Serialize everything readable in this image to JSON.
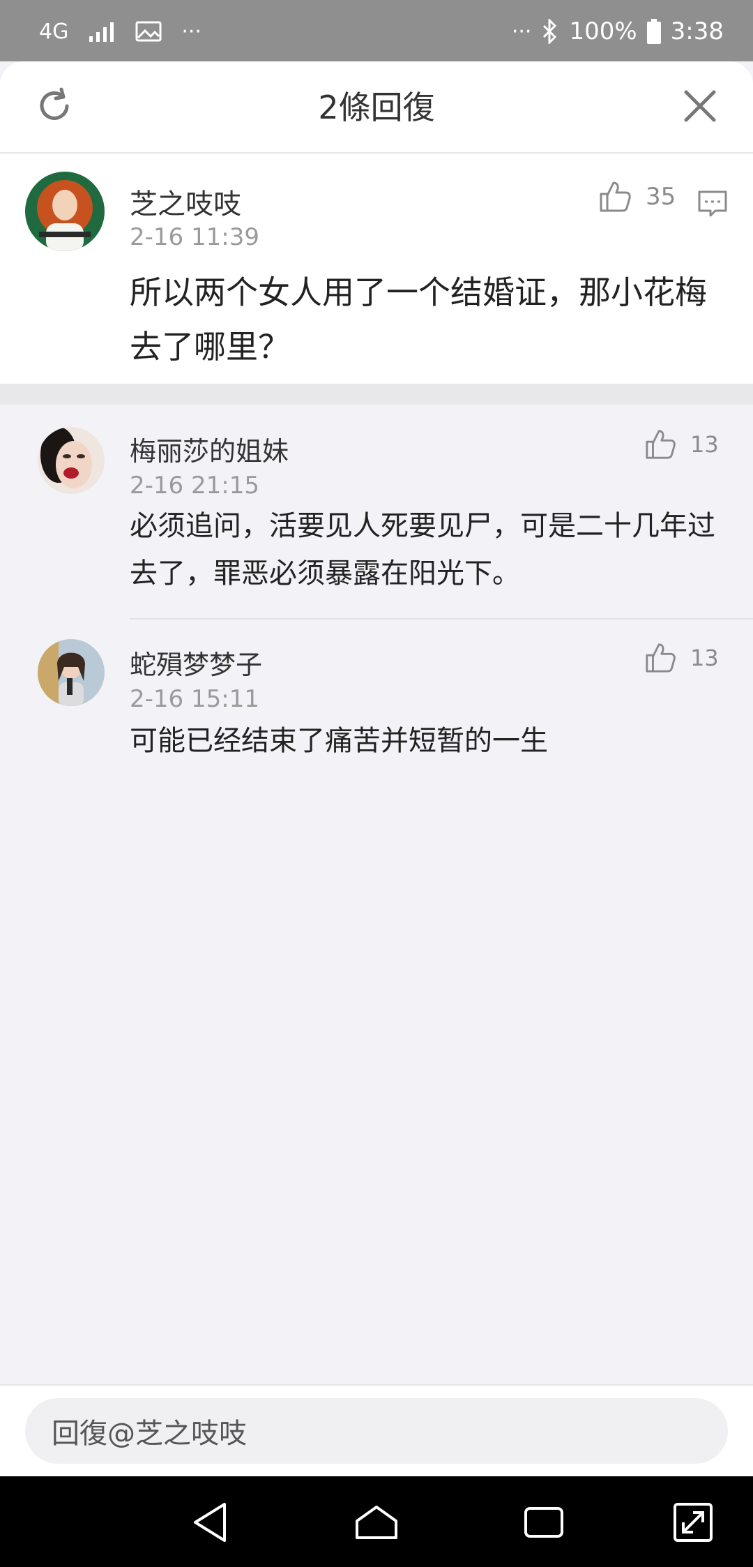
{
  "status_bar": {
    "network": "4G",
    "more_left": "···",
    "more_right": "···",
    "battery": "100%",
    "time": "3:38"
  },
  "header": {
    "title": "2條回復"
  },
  "main_comment": {
    "author": "芝之吱吱",
    "time": "2-16 11:39",
    "likes": "35",
    "content": "所以两个女人用了一个结婚证，那小花梅去了哪里？"
  },
  "replies": [
    {
      "author": "梅丽莎的姐妹",
      "time": "2-16 21:15",
      "likes": "13",
      "content": "必须追问，活要见人死要见尸，可是二十几年过去了，罪恶必须暴露在阳光下。"
    },
    {
      "author": "蛇殞梦梦子",
      "time": "2-16 15:11",
      "likes": "13",
      "content": "可能已经结束了痛苦并短暂的一生"
    }
  ],
  "bottom_bar": {
    "reply_placeholder": "回復@芝之吱吱"
  },
  "colors": {
    "header_bg": "#ffffff",
    "page_bg": "#f3f3f7",
    "status_bar_bg": "#8f8f8f",
    "nav_bar_bg": "#000000",
    "secondary_text": "#9a9a9a"
  }
}
